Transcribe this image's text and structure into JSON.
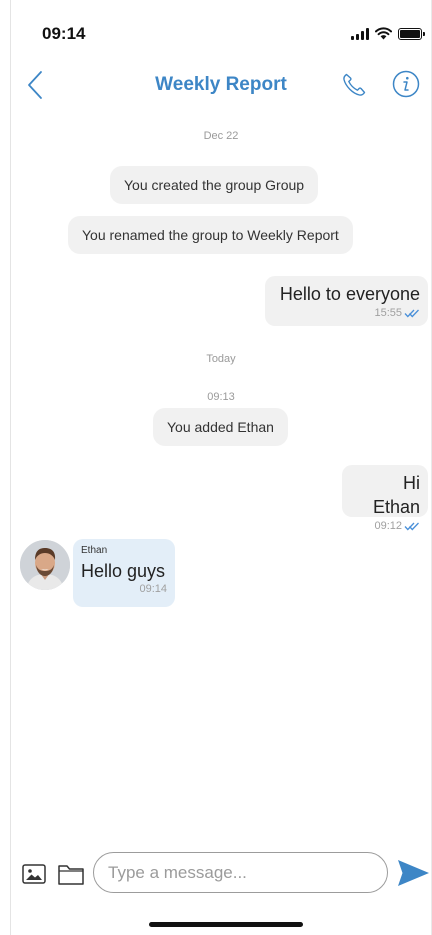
{
  "status_bar": {
    "time": "09:14"
  },
  "nav": {
    "title": "Weekly Report"
  },
  "messages": {
    "date_1": "Dec 22",
    "system_1": "You created the group Group",
    "system_2": "You renamed the group to Weekly Report",
    "outgoing_1": {
      "text": "Hello to everyone",
      "time": "15:55"
    },
    "date_2": "Today",
    "time_label": "09:13",
    "system_3": "You added Ethan",
    "outgoing_2": {
      "text": "Hi Ethan",
      "time": "09:12"
    },
    "incoming_1": {
      "sender": "Ethan",
      "text": "Hello guys",
      "time": "09:14"
    }
  },
  "composer": {
    "placeholder": "Type a message..."
  },
  "colors": {
    "accent": "#3d86c6",
    "bubble_in": "#e3eef8",
    "bubble_out": "#f1f1f1",
    "read_ticks": "#4a90d9"
  },
  "icons": [
    "back-chevron-icon",
    "phone-icon",
    "info-icon",
    "double-check-icon",
    "image-icon",
    "folder-icon",
    "send-icon"
  ]
}
